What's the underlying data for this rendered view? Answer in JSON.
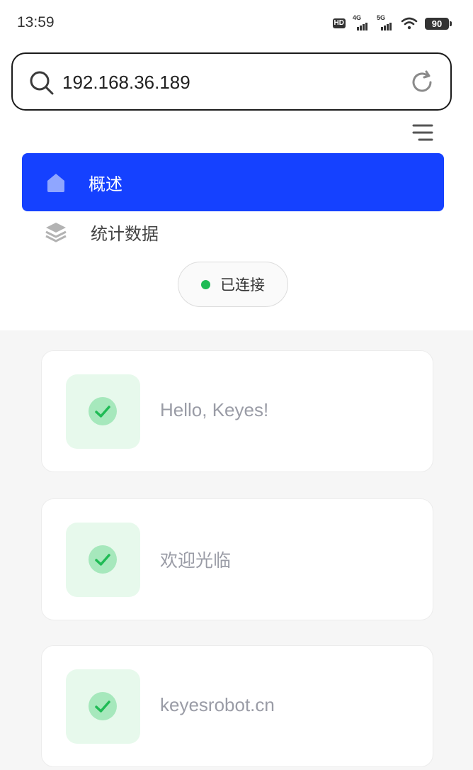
{
  "status_bar": {
    "time": "13:59",
    "hd_label": "HD",
    "signal_1_label": "4G",
    "signal_2_label": "5G",
    "battery_level": "90"
  },
  "address_bar": {
    "url": "192.168.36.189"
  },
  "nav": {
    "items": [
      {
        "label": "概述",
        "icon": "home-icon",
        "active": true
      },
      {
        "label": "统计数据",
        "icon": "layers-icon",
        "active": false
      }
    ]
  },
  "connection": {
    "status_label": "已连接",
    "status_color": "#1fbb55"
  },
  "messages": [
    {
      "text": "Hello, Keyes!",
      "icon": "check-icon"
    },
    {
      "text": "欢迎光临",
      "icon": "check-icon"
    },
    {
      "text": "keyesrobot.cn",
      "icon": "check-icon"
    }
  ],
  "colors": {
    "accent": "#1541ff",
    "success": "#1fbb55",
    "badge_bg": "#e7f9ec"
  }
}
